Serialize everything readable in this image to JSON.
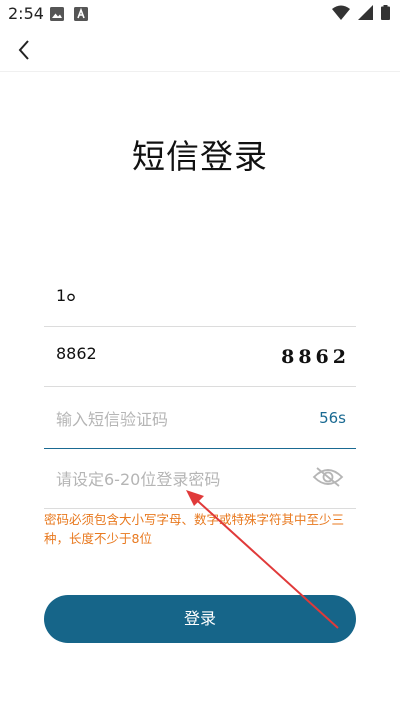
{
  "status_bar": {
    "time": "2:54"
  },
  "page": {
    "title": "短信登录"
  },
  "form": {
    "phone_value": "1๐",
    "captcha_value": "8862",
    "captcha_image_text": "8862",
    "sms_placeholder": "输入短信验证码",
    "sms_countdown": "56s",
    "password_placeholder": "请设定6-20位登录密码"
  },
  "hint": {
    "text": "密码必须包含大小写字母、数字或特殊字符其中至少三种，长度不少于8位"
  },
  "login_button": {
    "label": "登录"
  },
  "colors": {
    "accent": "#166589",
    "hint": "#e8791f",
    "annotation_arrow": "#e03a3a"
  }
}
